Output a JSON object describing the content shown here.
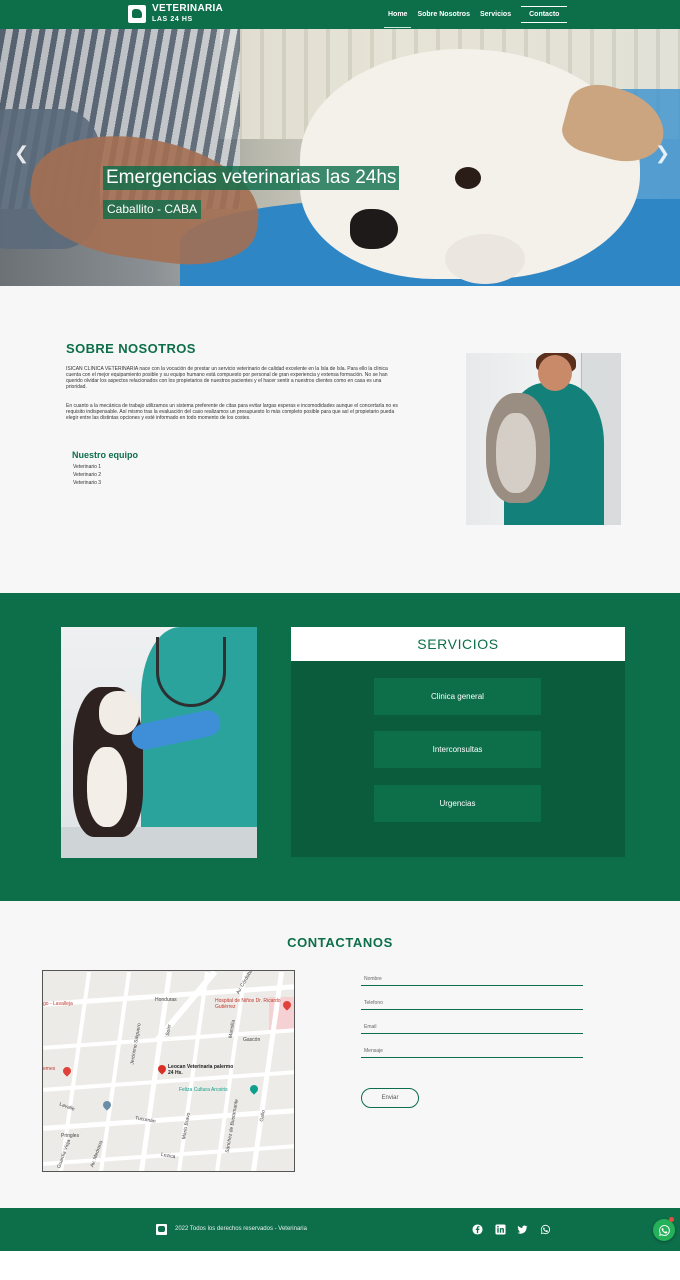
{
  "navbar": {
    "brand_title": "VETERINARIA",
    "brand_subtitle": "LAS 24 HS",
    "links": [
      {
        "label": "Home"
      },
      {
        "label": "Sobre Nosotros"
      },
      {
        "label": "Servicios"
      },
      {
        "label": "Contacto"
      }
    ],
    "active_link": "Home"
  },
  "hero": {
    "title": "Emergencias veterinarias las 24hs",
    "subtitle": "Caballito - CABA",
    "prev_icon": "chevron-left-icon",
    "next_icon": "chevron-right-icon"
  },
  "about": {
    "heading": "SOBRE NOSOTROS",
    "paragraph_1": "ISICAN CLINICA VETERINARIA nace con la vocación de prestar un servicio veterinario de calidad excelente en la Isla de Isla. Para ello la clínica cuenta con el mejor equipamiento posible y su equipo humano está compuesto por personal de gran experiencia y extensa formación. No se han querido olvidar los aspectos relacionados con los propietarios de nuestros pacientes y el hacer sentir a nuestros clientes como en casa es una prioridad.",
    "paragraph_2": "En cuanto a la mecánica de trabajo utilizamos un sistema preferente de citas para evitar largas esperas e incomodidades aunque el concertarla no es requisito indispensable. Así mismo tras la evaluación del caso realizamos un presupuesto lo más completo posible para que así el propietario pueda elegir entre las distintas opciones y esté informado en todo momento de los costes.",
    "team_heading": "Nuestro equipo",
    "team": [
      "Veterinario 1",
      "Veterinario 2",
      "Veterinario 3"
    ]
  },
  "services": {
    "heading": "SERVICIOS",
    "items": [
      {
        "label": "Clinica general"
      },
      {
        "label": "Interconsultas"
      },
      {
        "label": "Urgencias"
      }
    ]
  },
  "contact": {
    "heading": "CONTACTANOS",
    "map": {
      "labels": {
        "lavalleja": "go - Lavalleja",
        "honduras": "Honduras",
        "hospital": "Hospital de Niños Dr. Ricardo Gutiérrez",
        "av_cordoba": "Av. Córdoba",
        "sarmiento": "Jerónimo Salguero",
        "soler": "Soler",
        "gascon": "Gascón",
        "mansilla": "Mansilla",
        "medrano": "Medrano",
        "leocan": "Leocan Veterinaria palermo 24 Hs.",
        "feliza": "Feliza Cultura Arcoiris",
        "remes": "emes",
        "lavalle": "Lavalle",
        "tucuman": "Tucumán",
        "mario_bravo": "Mario Bravo",
        "sanchez": "Sánchez de Bustamante",
        "gallo": "Gallo",
        "lezica": "Lezica",
        "pringles": "Pringles",
        "rocamora": "Rocamora",
        "guardia_vieja": "Guardia Vieja",
        "medrano2": "Av. Medrano"
      }
    },
    "form": {
      "name_placeholder": "Nombre",
      "phone_placeholder": "Telefono",
      "email_placeholder": "Email",
      "message_placeholder": "Mensaje",
      "submit_label": "Enviar"
    }
  },
  "footer": {
    "copyright": "2022 Todos los derechos reservados - Veterinaria",
    "social": [
      "facebook-icon",
      "linkedin-icon",
      "twitter-icon",
      "whatsapp-icon"
    ]
  },
  "floating": {
    "icon": "whatsapp-icon"
  },
  "colors": {
    "brand_green": "#0d6e4a",
    "dark_green": "#0a5c3d",
    "background": "#f7f7f7"
  }
}
